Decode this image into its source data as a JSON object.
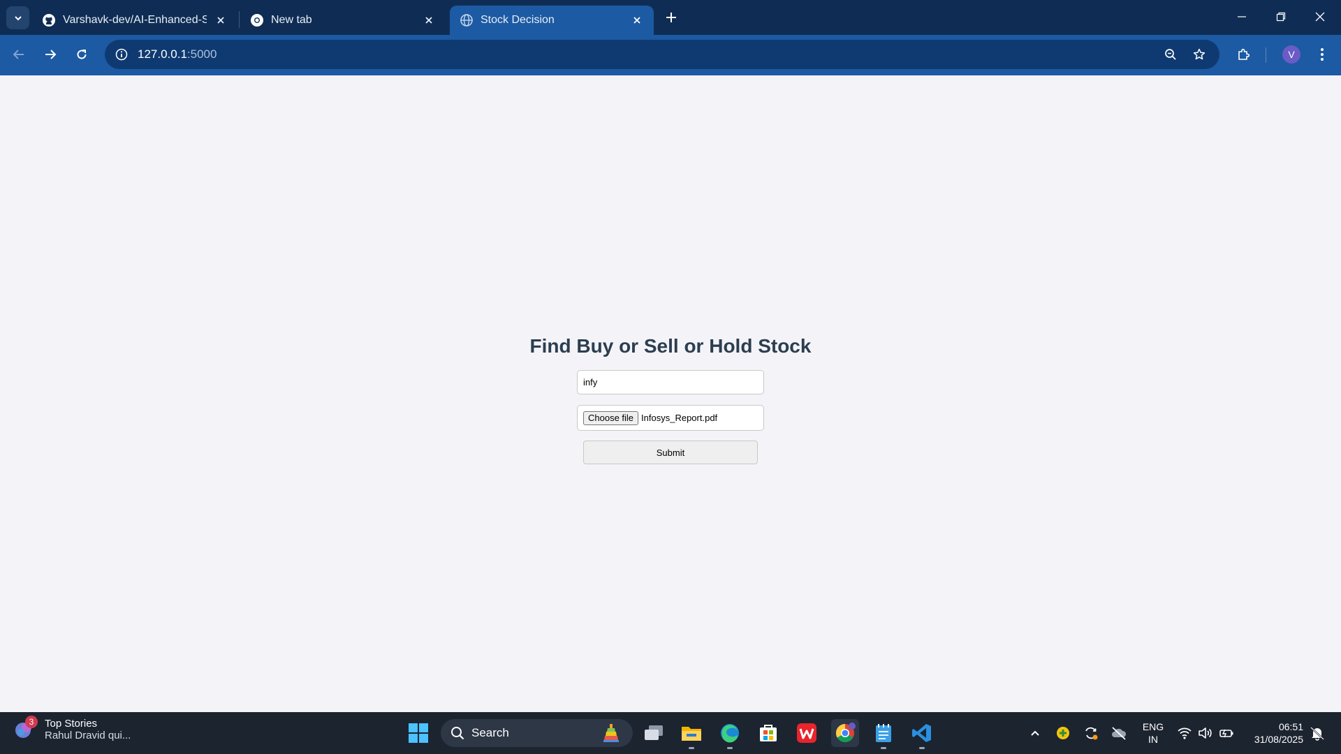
{
  "browser": {
    "tabs": [
      {
        "title": "Varshavk-dev/AI-Enhanced-Stock",
        "icon": "github-icon",
        "active": false
      },
      {
        "title": "New tab",
        "icon": "chrome-icon",
        "active": false
      },
      {
        "title": "Stock Decision",
        "icon": "globe-icon",
        "active": true
      }
    ],
    "address": {
      "host": "127.0.0.1",
      "port": ":5000"
    },
    "profile_initial": "V"
  },
  "page": {
    "title": "Find Buy or Sell or Hold Stock",
    "ticker_value": "infy",
    "file_button_label": "Choose file",
    "file_name": "Infosys_Report.pdf",
    "submit_label": "Submit"
  },
  "taskbar": {
    "news": {
      "badge": "3",
      "title": "Top Stories",
      "subtitle": "Rahul Dravid qui..."
    },
    "search_label": "Search",
    "apps": [
      "task-view",
      "file-explorer",
      "edge",
      "microsoft-store",
      "wps-office",
      "chrome",
      "notepad",
      "vs-code"
    ],
    "language": {
      "line1": "ENG",
      "line2": "IN"
    },
    "time": "06:51",
    "date": "31/08/2025"
  },
  "colors": {
    "tabstrip": "#0f2d54",
    "toolbar": "#1c5aa3",
    "page_bg": "#f4f4f8",
    "heading": "#2c3e50",
    "taskbar": "#1c2430"
  }
}
